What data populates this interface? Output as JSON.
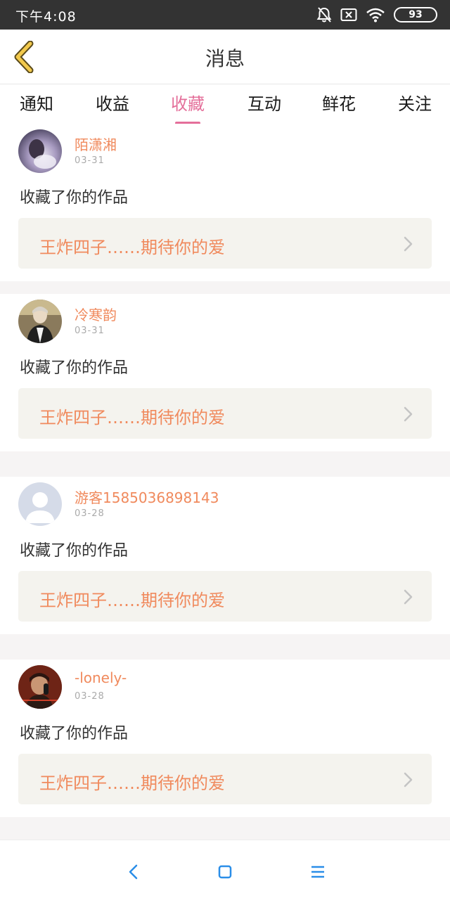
{
  "status_bar": {
    "time": "下午4:08",
    "battery": "93"
  },
  "nav": {
    "title": "消息"
  },
  "tabs": [
    {
      "label": "通知"
    },
    {
      "label": "收益"
    },
    {
      "label": "收藏"
    },
    {
      "label": "互动"
    },
    {
      "label": "鲜花"
    },
    {
      "label": "关注"
    }
  ],
  "active_tab": "收藏",
  "messages": [
    {
      "username": "陌潇湘",
      "date": "03-31",
      "action": "收藏了你的作品",
      "work_title": "王炸四子……期待你的爱"
    },
    {
      "username": "冷寒韵",
      "date": "03-31",
      "action": "收藏了你的作品",
      "work_title": "王炸四子……期待你的爱"
    },
    {
      "username": "游客1585036898143",
      "date": "03-28",
      "action": "收藏了你的作品",
      "work_title": "王炸四子……期待你的爱"
    },
    {
      "username": "-lonely-",
      "date": "03-28",
      "action": "收藏了你的作品",
      "work_title": "王炸四子……期待你的爱"
    }
  ],
  "colors": {
    "accent_pink": "#e46f9a",
    "accent_orange": "#f08a5d",
    "back_icon": "#f2c94c",
    "system_nav_blue": "#2a8ee8"
  },
  "icons": {
    "back": "chevron-left-icon",
    "mute": "bell-off-icon",
    "sim": "sim-x-icon",
    "wifi": "wifi-icon",
    "item_arrow": "chevron-right-icon",
    "system_back": "back-icon",
    "system_home": "home-icon",
    "system_menu": "menu-icon"
  }
}
